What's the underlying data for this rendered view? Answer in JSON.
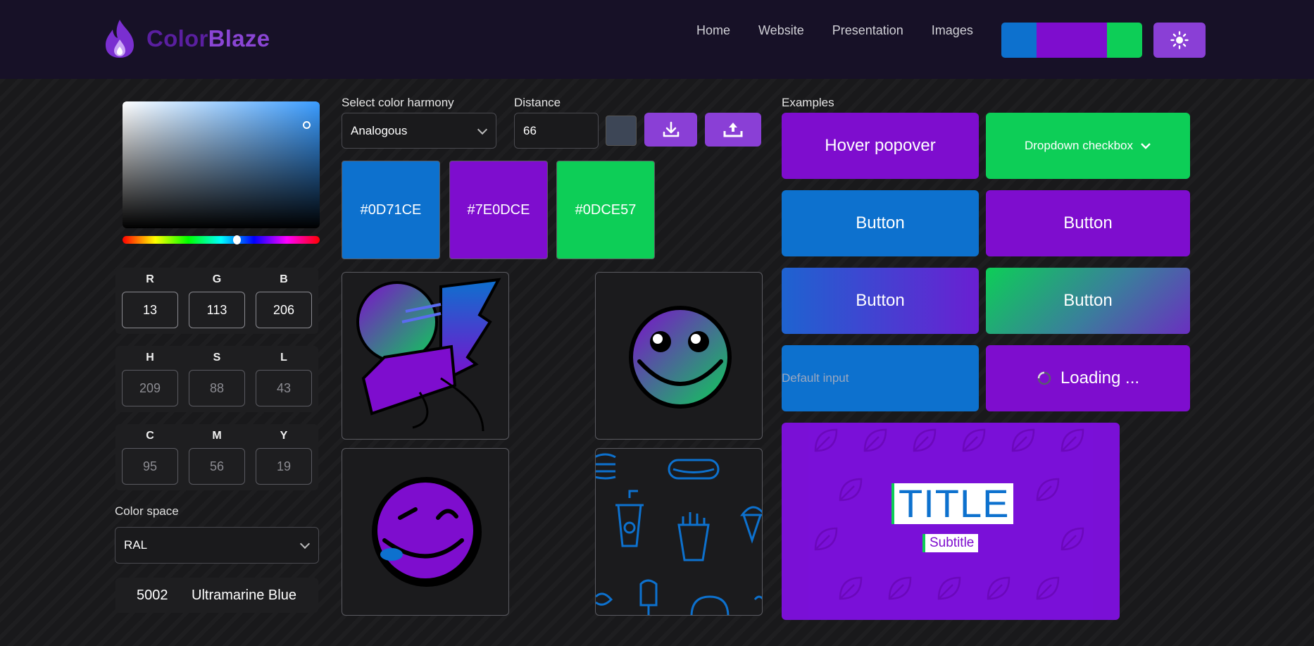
{
  "app": {
    "name_part1": "Color",
    "name_part2": "Blaze"
  },
  "nav": {
    "items": [
      "Home",
      "Website",
      "Presentation",
      "Images"
    ]
  },
  "palette": {
    "primary": "#0D71CE",
    "secondary": "#7E0DCE",
    "tertiary": "#0DCE57"
  },
  "rgb": {
    "r_label": "R",
    "g_label": "G",
    "b_label": "B",
    "r": "13",
    "g": "113",
    "b": "206"
  },
  "hsl": {
    "h_label": "H",
    "s_label": "S",
    "l_label": "L",
    "h": "209",
    "s": "88",
    "l": "43"
  },
  "cmy": {
    "c_label": "C",
    "m_label": "M",
    "y_label": "Y",
    "c": "95",
    "m": "56",
    "y": "19"
  },
  "color_space": {
    "label": "Color space",
    "selected": "RAL",
    "code": "5002",
    "name": "Ultramarine Blue"
  },
  "harmony": {
    "label": "Select color harmony",
    "selected": "Analogous",
    "distance_label": "Distance",
    "distance": "66",
    "swatches": [
      "#0D71CE",
      "#7E0DCE",
      "#0DCE57"
    ]
  },
  "examples": {
    "label": "Examples",
    "hover_popover": "Hover popover",
    "dropdown_checkbox": "Dropdown checkbox",
    "button": "Button",
    "default_input_placeholder": "Default input",
    "loading": "Loading ...",
    "title": "TITLE",
    "subtitle": "Subtitle"
  },
  "icons": {
    "logo": "flame-icon",
    "theme": "sun-icon",
    "download": "download-icon",
    "upload": "upload-icon",
    "chevron": "chevron-down-icon",
    "spinner": "spinner-icon"
  }
}
